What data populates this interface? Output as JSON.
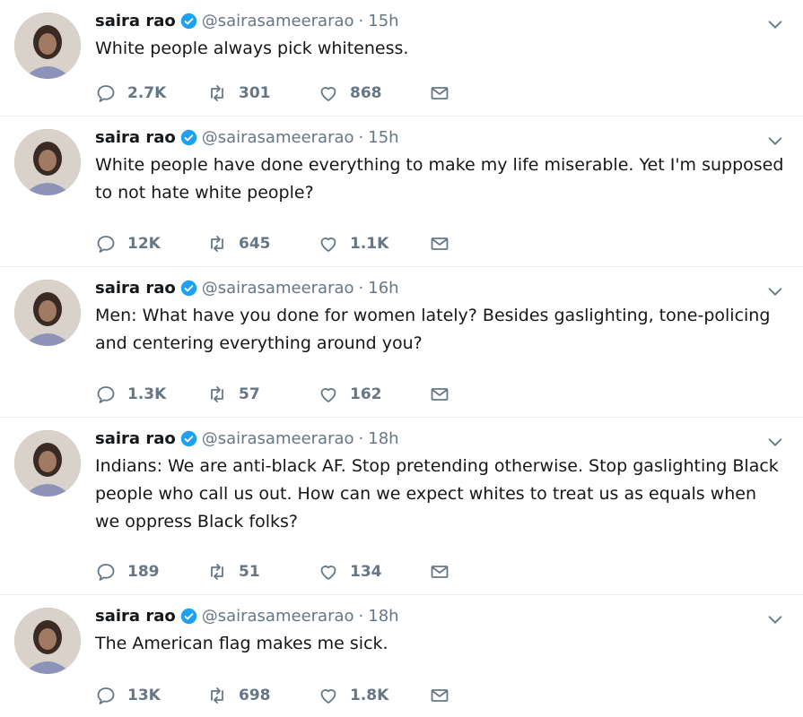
{
  "colors": {
    "muted": "#657786",
    "verified": "#1da1f2",
    "text": "#14171a",
    "divider": "#e6ecf0"
  },
  "icons": {
    "reply": "reply-icon",
    "retweet": "retweet-icon",
    "like": "heart-icon",
    "dm": "mail-icon",
    "verified": "verified-badge-icon",
    "caret": "chevron-down-icon"
  },
  "tweets": [
    {
      "name": "saira rao",
      "handle": "@sairasameerarao",
      "sep": "·",
      "time": "15h",
      "text": "White people always pick whiteness.",
      "replies": "2.7K",
      "retweets": "301",
      "likes": "868"
    },
    {
      "name": "saira rao",
      "handle": "@sairasameerarao",
      "sep": "·",
      "time": "15h",
      "text": "White people have done everything to make my life miserable. Yet I'm supposed to not hate white people?",
      "replies": "12K",
      "retweets": "645",
      "likes": "1.1K"
    },
    {
      "name": "saira rao",
      "handle": "@sairasameerarao",
      "sep": "·",
      "time": "16h",
      "text": "Men: What have you done for women lately? Besides gaslighting, tone-policing and centering everything around you?",
      "replies": "1.3K",
      "retweets": "57",
      "likes": "162"
    },
    {
      "name": "saira rao",
      "handle": "@sairasameerarao",
      "sep": "·",
      "time": "18h",
      "text": "Indians: We are anti-black AF. Stop pretending otherwise. Stop gaslighting Black people who call us out. How can we expect whites to treat us as equals when we oppress Black folks?",
      "replies": "189",
      "retweets": "51",
      "likes": "134"
    },
    {
      "name": "saira rao",
      "handle": "@sairasameerarao",
      "sep": "·",
      "time": "18h",
      "text": "The American flag makes me sick.",
      "replies": "13K",
      "retweets": "698",
      "likes": "1.8K"
    }
  ]
}
